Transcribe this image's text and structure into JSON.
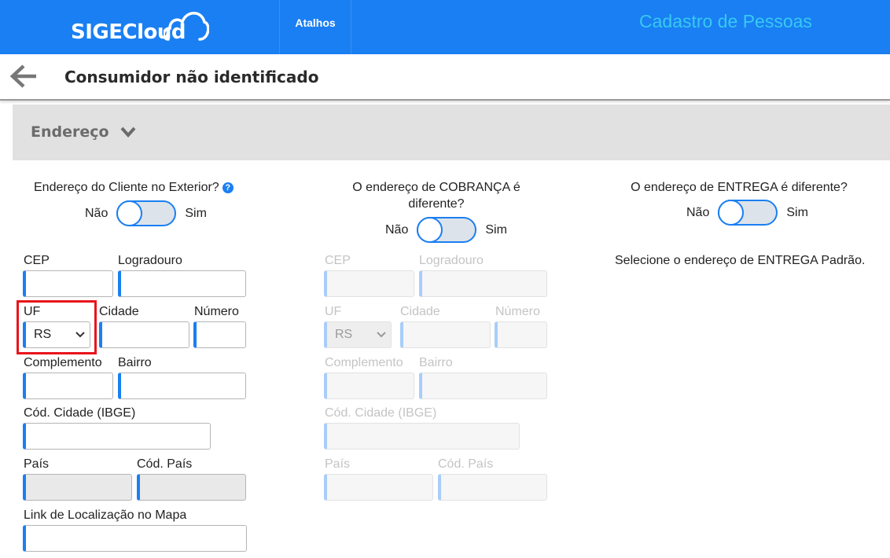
{
  "header": {
    "logo_sige": "SIGE",
    "logo_cloud": "Cloud",
    "shortcuts_label": "Atalhos",
    "app_title": "Cadastro de Pessoas"
  },
  "subheader": {
    "back_icon": "arrow-left-icon",
    "title": "Consumidor não identificado"
  },
  "section": {
    "title": "Endereço",
    "toggle_icon": "chevron-down-icon"
  },
  "columns": {
    "exterior": {
      "question": "Endereço do Cliente no Exterior?",
      "help": "?",
      "off": "Não",
      "on": "Sim"
    },
    "billing": {
      "question_line1": "O endereço de COBRANÇA é",
      "question_line2": "diferente?",
      "off": "Não",
      "on": "Sim"
    },
    "delivery": {
      "question": "O endereço de ENTREGA é diferente?",
      "off": "Não",
      "on": "Sim",
      "note": "Selecione o endereço de ENTREGA Padrão."
    }
  },
  "form": {
    "cep": "CEP",
    "logradouro": "Logradouro",
    "uf": "UF",
    "uf_value": "RS",
    "cidade": "Cidade",
    "numero": "Número",
    "complemento": "Complemento",
    "bairro": "Bairro",
    "cod_cidade": "Cód. Cidade (IBGE)",
    "pais": "País",
    "cod_pais": "Cód. País",
    "link_mapa": "Link de Localização no Mapa"
  },
  "colors": {
    "brand": "#1a7ff2",
    "app_title": "#36c9f3",
    "highlight": "#e8141b"
  }
}
